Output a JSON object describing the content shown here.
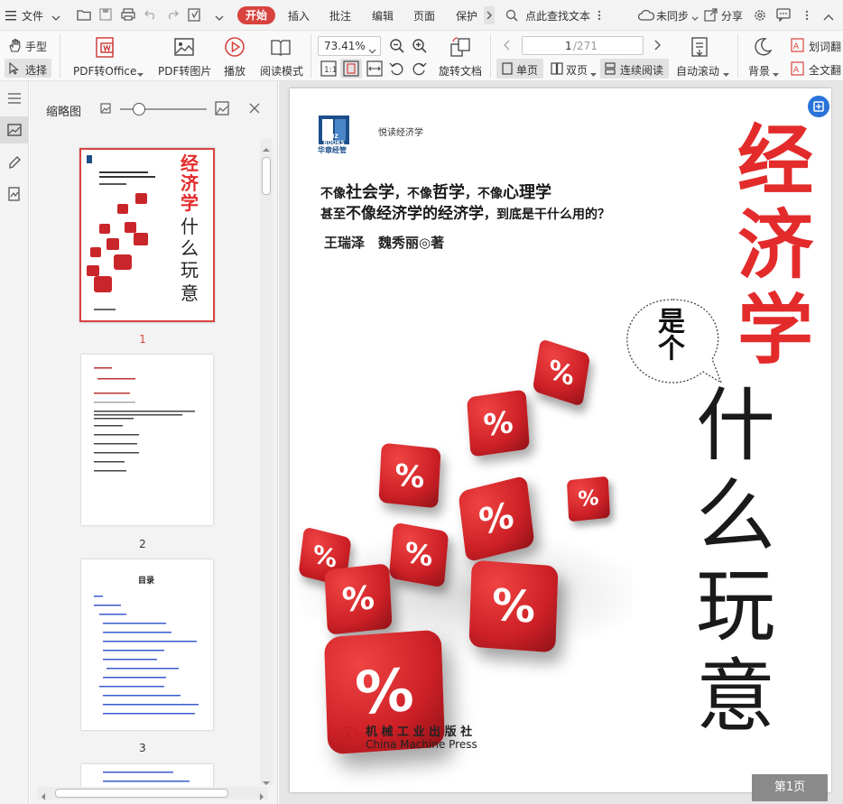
{
  "menubar": {
    "file": "文件",
    "tabs": [
      "开始",
      "插入",
      "批注",
      "编辑",
      "页面",
      "保护"
    ],
    "search_placeholder": "点此查找文本",
    "sync": "未同步",
    "share": "分享"
  },
  "toolbar": {
    "hand": "手型",
    "select": "选择",
    "pdf_to_office": "PDF转Office",
    "pdf_to_image": "PDF转图片",
    "play": "播放",
    "read_mode": "阅读模式",
    "zoom": "73.41%",
    "rotate_doc": "旋转文档",
    "page_current": "1",
    "page_total": "/271",
    "single_page": "单页",
    "double_page": "双页",
    "continuous_read": "连续阅读",
    "auto_scroll": "自动滚动",
    "background": "背景",
    "word_mark": "划词翻",
    "full_text": "全文翻"
  },
  "thumb_panel": {
    "title": "缩略图",
    "page_numbers": [
      "1",
      "2",
      "3"
    ],
    "toc_title": "目录"
  },
  "cover": {
    "series": "悦读经济学",
    "publisher_logo_text": "HZ BOOKS",
    "publisher_logo_cn": "华章经管",
    "tagline_line1_parts": [
      "不像",
      "社会学",
      "，不像",
      "哲学",
      "，不像",
      "心理学"
    ],
    "tagline_line2_parts": [
      "甚至",
      "不像经济学的经济学",
      "，到底是干什么用的？"
    ],
    "authors": "王瑞泽　魏秀丽◎著",
    "title_red": [
      "经",
      "济",
      "学"
    ],
    "bubble": "是个",
    "title_black": [
      "什",
      "么",
      "玩",
      "意"
    ],
    "dice_symbol": "%",
    "publisher_cn": "机 械 工 业 出 版 社",
    "publisher_en": "China Machine Press"
  },
  "status": {
    "page_badge": "第1页"
  },
  "colors": {
    "accent_red": "#d9433f",
    "title_red": "#e32b2b",
    "link_blue": "#2a73d9"
  }
}
